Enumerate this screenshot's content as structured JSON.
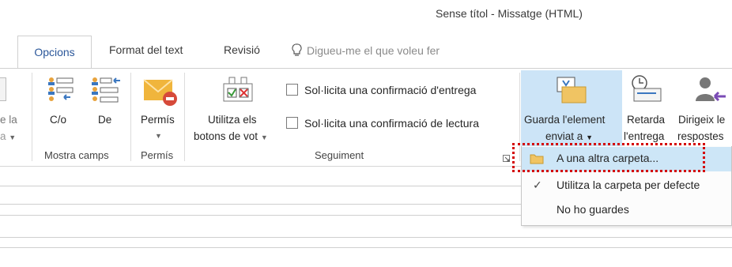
{
  "window": {
    "title": "Sense títol - Missatge (HTML)"
  },
  "tabs": [
    {
      "label": "Opcions",
      "active": true
    },
    {
      "label": "Format del text",
      "active": false
    },
    {
      "label": "Revisió",
      "active": false
    }
  ],
  "tell_me": {
    "placeholder": "Digueu-me el que voleu fer"
  },
  "ribbon": {
    "partial_button": {
      "line1": "e la",
      "line2": "a"
    },
    "groups": {
      "mostra_camps": {
        "label": "Mostra camps",
        "buttons": [
          {
            "label": "C/o"
          },
          {
            "label": "De"
          }
        ]
      },
      "permis": {
        "label": "Permís",
        "buttons": [
          {
            "label": "Permís"
          }
        ]
      },
      "seguiment": {
        "label": "Seguiment",
        "vote_button": {
          "line1": "Utilitza els",
          "line2": "botons de vot"
        },
        "checkboxes": [
          {
            "label": "Sol·licita una confirmació d'entrega",
            "checked": false
          },
          {
            "label": "Sol·licita una confirmació de lectura",
            "checked": false
          }
        ]
      },
      "more": {
        "save_sent": {
          "line1": "Guarda l'element",
          "line2": "enviat a"
        },
        "delay": {
          "line1": "Retarda",
          "line2": "l'entrega"
        },
        "direct": {
          "line1": "Dirigeix le",
          "line2": "respostes"
        }
      }
    }
  },
  "dropdown": {
    "items": [
      {
        "label": "A una altra carpeta...",
        "selected": true,
        "checked": false
      },
      {
        "label": "Utilitza la carpeta per defecte",
        "selected": false,
        "checked": true
      },
      {
        "label": "No ho guardes",
        "selected": false,
        "checked": false
      }
    ]
  },
  "colors": {
    "accent": "#2b579a",
    "selected": "#cde6f7",
    "annotation": "#d40000"
  }
}
